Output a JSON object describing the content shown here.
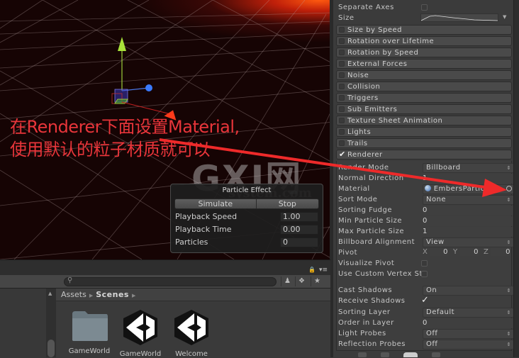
{
  "annotation": {
    "line1": "在Renderer下面设置Material,",
    "line2": "使用默认的粒子材质就可以",
    "color": "#e8353a"
  },
  "watermark": {
    "main": "GXI网",
    "sub": "system.com"
  },
  "particle_effect": {
    "title": "Particle Effect",
    "simulate_label": "Simulate",
    "stop_label": "Stop",
    "rows": [
      {
        "label": "Playback Speed",
        "value": "1.00"
      },
      {
        "label": "Playback Time",
        "value": "0.00"
      },
      {
        "label": "Particles",
        "value": "0"
      }
    ]
  },
  "project": {
    "search_placeholder": "",
    "breadcrumb": {
      "root": "Assets",
      "current": "Scenes"
    },
    "assets": [
      {
        "name": "GameWorld",
        "type": "folder-icon"
      },
      {
        "name": "GameWorld",
        "type": "unity-scene-icon"
      },
      {
        "name": "Welcome",
        "type": "unity-scene-icon"
      }
    ]
  },
  "inspector": {
    "size_section": {
      "separate_axes_label": "Separate Axes",
      "size_label": "Size"
    },
    "modules": [
      {
        "label": "Size by Speed",
        "enabled": false
      },
      {
        "label": "Rotation over Lifetime",
        "enabled": false
      },
      {
        "label": "Rotation by Speed",
        "enabled": false
      },
      {
        "label": "External Forces",
        "enabled": false
      },
      {
        "label": "Noise",
        "enabled": false
      },
      {
        "label": "Collision",
        "enabled": false
      },
      {
        "label": "Triggers",
        "enabled": false
      },
      {
        "label": "Sub Emitters",
        "enabled": false
      },
      {
        "label": "Texture Sheet Animation",
        "enabled": false
      },
      {
        "label": "Lights",
        "enabled": false
      },
      {
        "label": "Trails",
        "enabled": false
      },
      {
        "label": "Renderer",
        "enabled": true
      }
    ],
    "renderer": {
      "render_mode": {
        "label": "Render Mode",
        "value": "Billboard"
      },
      "normal_direction": {
        "label": "Normal Direction",
        "value": "1"
      },
      "material": {
        "label": "Material",
        "value": "EmbersParticle"
      },
      "sort_mode": {
        "label": "Sort Mode",
        "value": "None"
      },
      "sorting_fudge": {
        "label": "Sorting Fudge",
        "value": "0"
      },
      "min_particle_size": {
        "label": "Min Particle Size",
        "value": "0"
      },
      "max_particle_size": {
        "label": "Max Particle Size",
        "value": "1"
      },
      "billboard_alignment": {
        "label": "Billboard Alignment",
        "value": "View"
      },
      "pivot": {
        "label": "Pivot",
        "x_label": "X",
        "x": "0",
        "y_label": "Y",
        "y": "0",
        "z_label": "Z",
        "z": "0"
      },
      "visualize_pivot": {
        "label": "Visualize Pivot",
        "checked": false
      },
      "custom_vertex": {
        "label": "Use Custom Vertex Streams",
        "checked": false
      },
      "cast_shadows": {
        "label": "Cast Shadows",
        "value": "On"
      },
      "receive_shadows": {
        "label": "Receive Shadows",
        "checked": true
      },
      "sorting_layer": {
        "label": "Sorting Layer",
        "value": "Default"
      },
      "order_in_layer": {
        "label": "Order in Layer",
        "value": "0"
      },
      "light_probes": {
        "label": "Light Probes",
        "value": "Off"
      },
      "reflection_probes": {
        "label": "Reflection Probes",
        "value": "Off"
      }
    }
  }
}
